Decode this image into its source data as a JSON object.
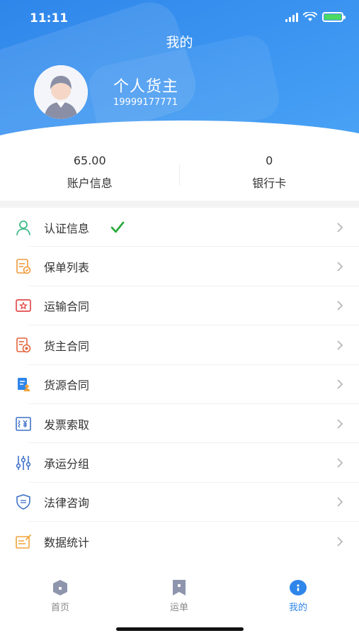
{
  "status": {
    "time": "11:11"
  },
  "header": {
    "title": "我的"
  },
  "profile": {
    "name": "个人货主",
    "phone": "19999177771"
  },
  "stats": [
    {
      "value": "65.00",
      "label": "账户信息"
    },
    {
      "value": "0",
      "label": "银行卡"
    }
  ],
  "menu": [
    {
      "label": "认证信息",
      "icon": "user-icon",
      "verified": true
    },
    {
      "label": "保单列表",
      "icon": "policy-list-icon"
    },
    {
      "label": "运输合同",
      "icon": "transport-contract-icon"
    },
    {
      "label": "货主合同",
      "icon": "shipper-contract-icon"
    },
    {
      "label": "货源合同",
      "icon": "source-contract-icon"
    },
    {
      "label": "发票索取",
      "icon": "invoice-icon"
    },
    {
      "label": "承运分组",
      "icon": "carrier-group-icon"
    },
    {
      "label": "法律咨询",
      "icon": "legal-shield-icon"
    },
    {
      "label": "数据统计",
      "icon": "statistics-icon"
    }
  ],
  "tabs": [
    {
      "label": "首页",
      "icon": "home-icon"
    },
    {
      "label": "运单",
      "icon": "waybill-icon"
    },
    {
      "label": "我的",
      "icon": "profile-icon"
    }
  ],
  "colors": {
    "accent": "#2f86ea",
    "check": "#27a839"
  }
}
